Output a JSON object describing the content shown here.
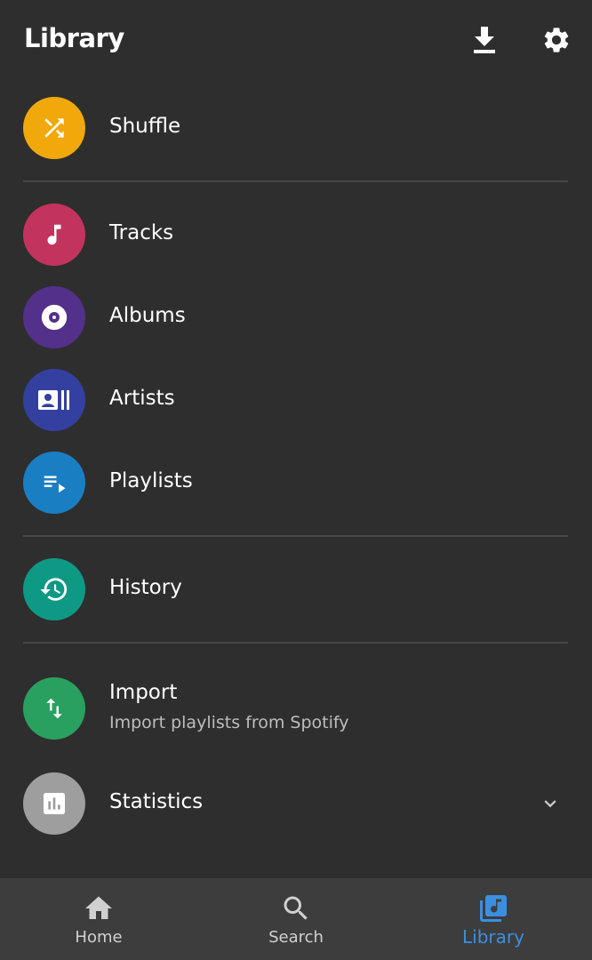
{
  "header": {
    "title": "Library"
  },
  "colors": {
    "background": "#2e2e2e",
    "shuffle": "#f0a80a",
    "tracks": "#c2335e",
    "albums": "#53308a",
    "artists": "#3440a0",
    "playlists": "#1a7ec3",
    "history": "#0e9984",
    "import": "#2aa060",
    "statistics": "#9e9e9e",
    "accent": "#3b8fe0"
  },
  "items": {
    "shuffle": {
      "label": "Shuffle",
      "icon": "shuffle-icon"
    },
    "tracks": {
      "label": "Tracks",
      "icon": "music-note-icon"
    },
    "albums": {
      "label": "Albums",
      "icon": "album-icon"
    },
    "artists": {
      "label": "Artists",
      "icon": "artist-icon"
    },
    "playlists": {
      "label": "Playlists",
      "icon": "playlist-icon"
    },
    "history": {
      "label": "History",
      "icon": "history-icon"
    },
    "import": {
      "label": "Import",
      "sublabel": "Import playlists from Spotify",
      "icon": "import-icon"
    },
    "statistics": {
      "label": "Statistics",
      "icon": "statistics-icon"
    }
  },
  "bottom_nav": {
    "home": "Home",
    "search": "Search",
    "library": "Library"
  }
}
